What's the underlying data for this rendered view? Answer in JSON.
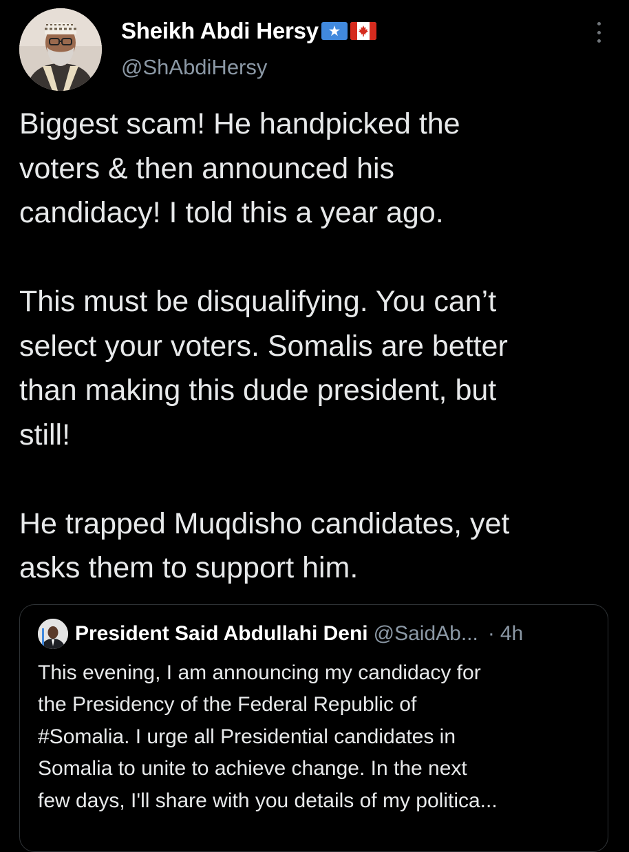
{
  "tweet": {
    "author": {
      "name": "Sheikh Abdi Hersy",
      "handle": "@ShAbdiHersy",
      "flags": [
        "somalia-flag",
        "canada-flag"
      ]
    },
    "paragraphs": [
      "Biggest scam! He handpicked the\nvoters & then announced his\ncandidacy! I told this a year ago.",
      "This must be disqualifying. You can’t\nselect your voters. Somalis are better\nthan making this dude president, but\nstill!",
      "He trapped Muqdisho candidates, yet\nasks them to support him."
    ],
    "menu_icon": "more-vertical-icon"
  },
  "quoted_tweet": {
    "author_name": "President Said Abdullahi Deni",
    "handle": "@SaidAb...",
    "separator": "·",
    "time": "4h",
    "text": "This evening, I am announcing my candidacy for\nthe Presidency of the Federal Republic of\n#Somalia. I urge all Presidential candidates in\nSomalia to unite to achieve change. In the next\nfew days, I'll share with you details of my politica..."
  },
  "colors": {
    "background": "#000000",
    "text_primary": "#e7e9ea",
    "text_secondary": "#8b98a5",
    "border": "#2f3336",
    "somalia_blue": "#4189dd",
    "canada_red": "#d52b1e"
  }
}
